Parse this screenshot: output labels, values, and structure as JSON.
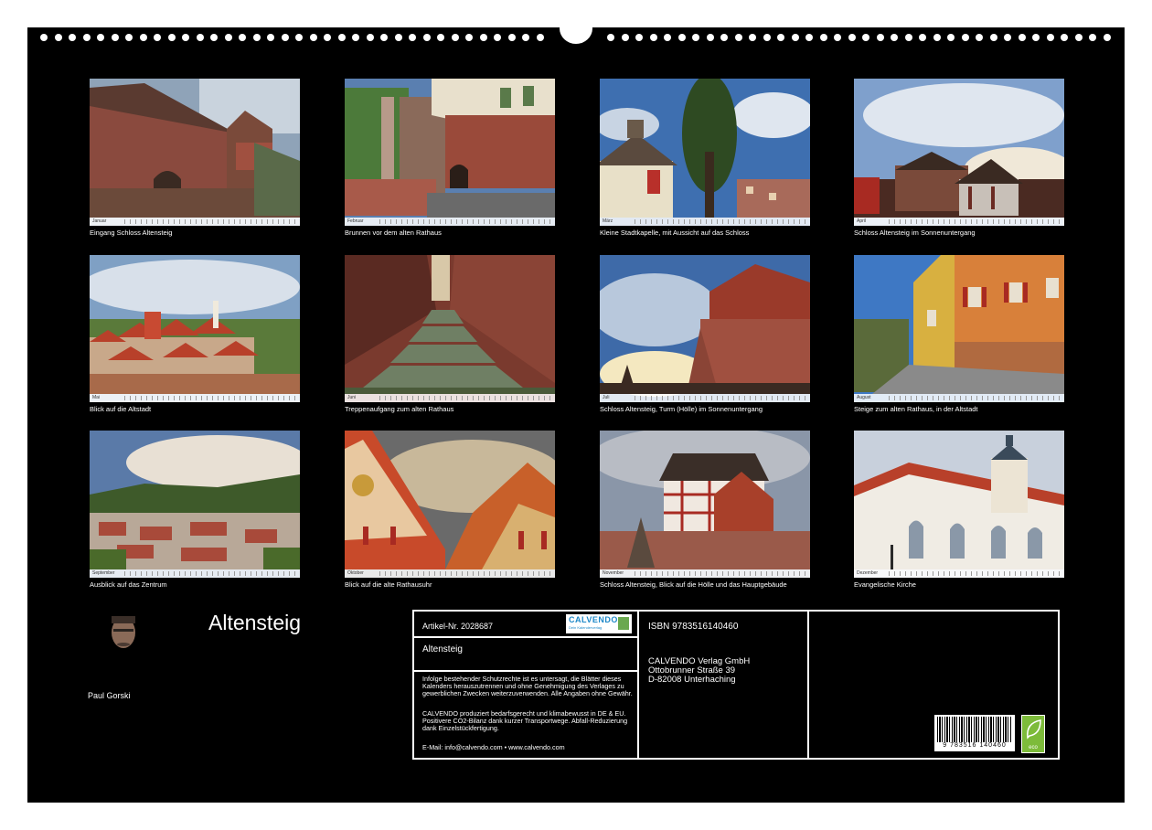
{
  "calendar": {
    "title": "Altensteig",
    "author": "Paul Gorski"
  },
  "months": [
    {
      "caption": "Eingang Schloss Altensteig",
      "month_label": "Januar"
    },
    {
      "caption": "Brunnen vor dem alten Rathaus",
      "month_label": "Februar"
    },
    {
      "caption": "Kleine Stadtkapelle, mit Aussicht auf das Schloss",
      "month_label": "März"
    },
    {
      "caption": "Schloss Altensteig im Sonnenuntergang",
      "month_label": "April"
    },
    {
      "caption": "Blick auf die Altstadt",
      "month_label": "Mai"
    },
    {
      "caption": "Treppenaufgang zum alten Rathaus",
      "month_label": "Juni"
    },
    {
      "caption": "Schloss Altensteig, Turm (Hölle) im Sonnenuntergang",
      "month_label": "Juli"
    },
    {
      "caption": "Steige zum alten Rathaus, in der Altstadt",
      "month_label": "August"
    },
    {
      "caption": "Ausblick auf das Zentrum",
      "month_label": "September"
    },
    {
      "caption": "Blick auf die alte Rathausuhr",
      "month_label": "Oktober"
    },
    {
      "caption": "Schloss Altensteig, Blick auf die Hölle und das Hauptgebäude",
      "month_label": "November"
    },
    {
      "caption": "Evangelische Kirche",
      "month_label": "Dezember"
    }
  ],
  "info": {
    "article_no": "Artikel-Nr. 2028687",
    "product_title": "Altensteig",
    "isbn": "ISBN 9783516140460",
    "publisher": [
      "CALVENDO Verlag GmbH",
      "Ottobrunner Straße 39",
      "D-82008 Unterhaching"
    ],
    "legal_1": "Infolge bestehender Schutzrechte ist es untersagt, die Blätter dieses Kalenders herauszutrennen und ohne Genehmigung des Verlages zu gewerblichen Zwecken weiterzuverwenden. Alle Angaben ohne Gewähr.",
    "legal_2": "CALVENDO produziert bedarfsgerecht und klimabewusst in DE & EU. Positivere CO2-Bilanz dank kurzer Transportwege. Abfall-Reduzierung dank Einzelstückfertigung.",
    "contact": "E-Mail: info@calvendo.com • www.calvendo.com",
    "logo_name": "CALVENDO",
    "logo_sub": "Dein Kalenderverlag",
    "barcode_number": "9 783516 140460",
    "eco_label": "eco"
  },
  "colors": {
    "background": "#000000",
    "logo_blue": "#1e88c8",
    "eco_green": "#7dbb3a"
  }
}
